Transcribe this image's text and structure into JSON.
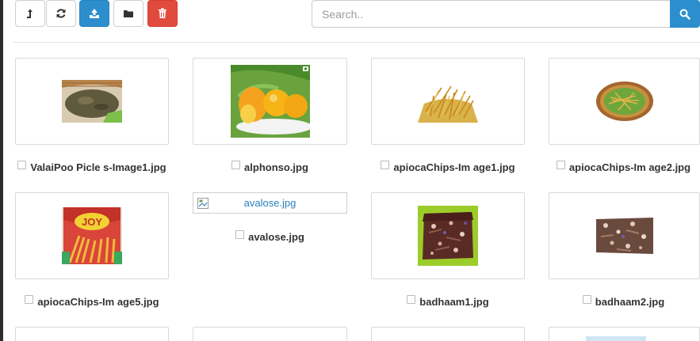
{
  "toolbar": {
    "buttons": [
      {
        "name": "up-directory-button",
        "icon": "level-up-icon"
      },
      {
        "name": "refresh-button",
        "icon": "refresh-icon"
      },
      {
        "name": "upload-button",
        "icon": "upload-icon"
      },
      {
        "name": "new-folder-button",
        "icon": "folder-icon"
      },
      {
        "name": "delete-button",
        "icon": "trash-icon"
      }
    ],
    "search_placeholder": "Search..",
    "colors": {
      "upload": "#2d8ecd",
      "delete": "#e14b3e",
      "search": "#2d8ecd"
    }
  },
  "files": [
    {
      "name": "ValaiPoo Picle s-Image1.jpg"
    },
    {
      "name": "alphonso.jpg"
    },
    {
      "name": "apiocaChips-Im age1.jpg"
    },
    {
      "name": "apiocaChips-Im age2.jpg"
    },
    {
      "name": "apiocaChips-Im age5.jpg"
    },
    {
      "name": "avalose.jpg",
      "alt": "avalose.jpg",
      "broken": true
    },
    {
      "name": "badhaam1.jpg"
    },
    {
      "name": "badhaam2.jpg"
    }
  ]
}
